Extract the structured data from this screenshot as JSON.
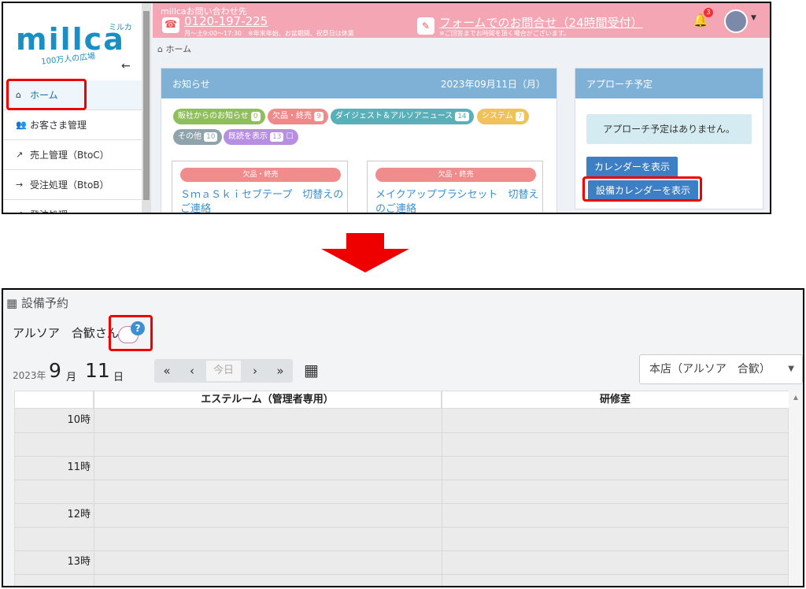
{
  "top": {
    "logo": {
      "text": "millca",
      "kana": "ミルカ",
      "tagline": "100万人の広場"
    },
    "nav": [
      {
        "label": "ホーム",
        "icon": "home-icon"
      },
      {
        "label": "お客さま管理",
        "icon": "users-icon"
      },
      {
        "label": "売上管理（BtoC）",
        "icon": "chart-line-icon"
      },
      {
        "label": "受注処理（BtoB）",
        "icon": "sign-in-icon"
      },
      {
        "label": "発注処理",
        "icon": "order-icon"
      }
    ],
    "contact": {
      "title": "millcaお問い合わせ先",
      "tel": "0120-197-225",
      "hours": "月～土9:00～17:30　※年末年始、お盆期間、祝祭日は休業",
      "form_link": "フォームでのお問合せ（24時間受付）",
      "form_note": "※ご回答までお時間を頂く場合がございます。"
    },
    "notifications": "3",
    "breadcrumb": "ホーム",
    "news": {
      "title": "お知らせ",
      "date": "2023年09月11日（月）",
      "tags": [
        {
          "label": "販社からのお知らせ",
          "count": "0",
          "color": "#8fbf5a"
        },
        {
          "label": "欠品・終売",
          "count": "9",
          "color": "#ef8a8a"
        },
        {
          "label": "ダイジェスト＆アルソアニュース",
          "count": "14",
          "color": "#5ab0b8"
        },
        {
          "label": "システム",
          "count": "7",
          "color": "#f2c25a"
        },
        {
          "label": "その他",
          "count": "10",
          "color": "#8fa3ad"
        },
        {
          "label": "既読を表示",
          "count": "13",
          "color": "#b78fe0"
        }
      ],
      "cards": [
        {
          "category": "欠品・終売",
          "title": "ＳｍａＳｋｉセブテープ　切替えのご連絡"
        },
        {
          "category": "欠品・終売",
          "title": "メイクアップブラシセット　切替えのご連絡"
        }
      ]
    },
    "approach": {
      "title": "アプローチ予定",
      "empty": "アプローチ予定はありません。",
      "calendar_btn": "カレンダーを表示",
      "equipment_btn": "設備カレンダーを表示"
    }
  },
  "bottom": {
    "title": "設備予約",
    "user": "アルソア　合歓さん",
    "date": {
      "year": "2023",
      "year_unit": "年",
      "month": "9",
      "month_unit": "月",
      "day": "11",
      "day_unit": "日"
    },
    "nav": {
      "first": "«",
      "prev": "‹",
      "today": "今日",
      "next": "›",
      "last": "»"
    },
    "store": "本店（アルソア　合歓）",
    "rooms": [
      "エステルーム（管理者専用）",
      "研修室"
    ],
    "hours": [
      "10時",
      "11時",
      "12時",
      "13時"
    ]
  }
}
